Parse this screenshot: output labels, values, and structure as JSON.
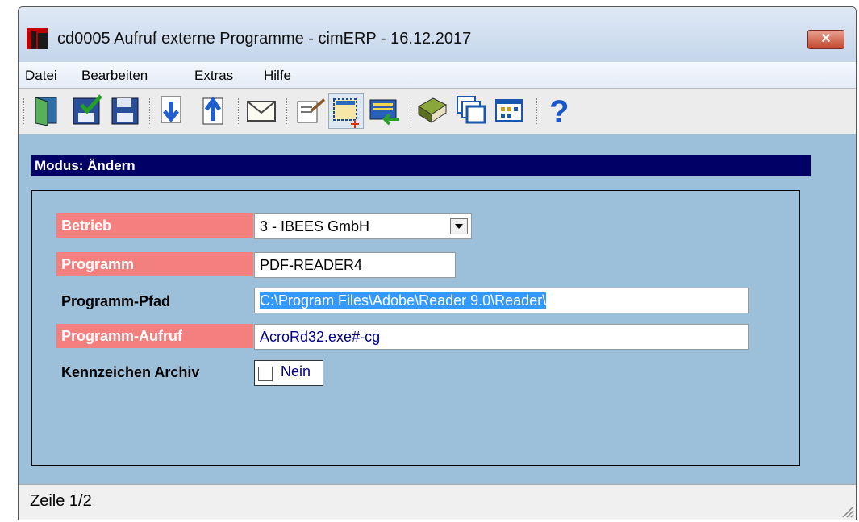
{
  "window": {
    "title": "cd0005 Aufruf externe Programme - cimERP - 16.12.2017",
    "close_label": "✕"
  },
  "menu": [
    "Datei",
    "Bearbeiten",
    "Extras",
    "Hilfe"
  ],
  "toolbar": {
    "icons": [
      "exit-icon",
      "save-check-icon",
      "save-icon",
      "record-down-icon",
      "record-up-icon",
      "mail-icon",
      "edit-note-icon",
      "new-record-icon",
      "transfer-icon",
      "book-icon",
      "windows-icon",
      "grid-icon",
      "help-icon"
    ]
  },
  "mode": "Modus: Ändern",
  "form": {
    "betrieb_label": "Betrieb",
    "betrieb_value": "3 - IBEES GmbH",
    "programm_label": "Programm",
    "programm_value": "PDF-READER4",
    "pfad_label": "Programm-Pfad",
    "pfad_value": "C:\\Program Files\\Adobe\\Reader 9.0\\Reader\\",
    "aufruf_label": "Programm-Aufruf",
    "aufruf_value": "AcroRd32.exe#-cg",
    "archiv_label": "Kennzeichen Archiv",
    "archiv_value": "Nein"
  },
  "status": "Zeile 1/2",
  "colors": {
    "mode_bar": "#000066",
    "required_label": "#f47f7f",
    "content_bg": "#9dc0da"
  }
}
